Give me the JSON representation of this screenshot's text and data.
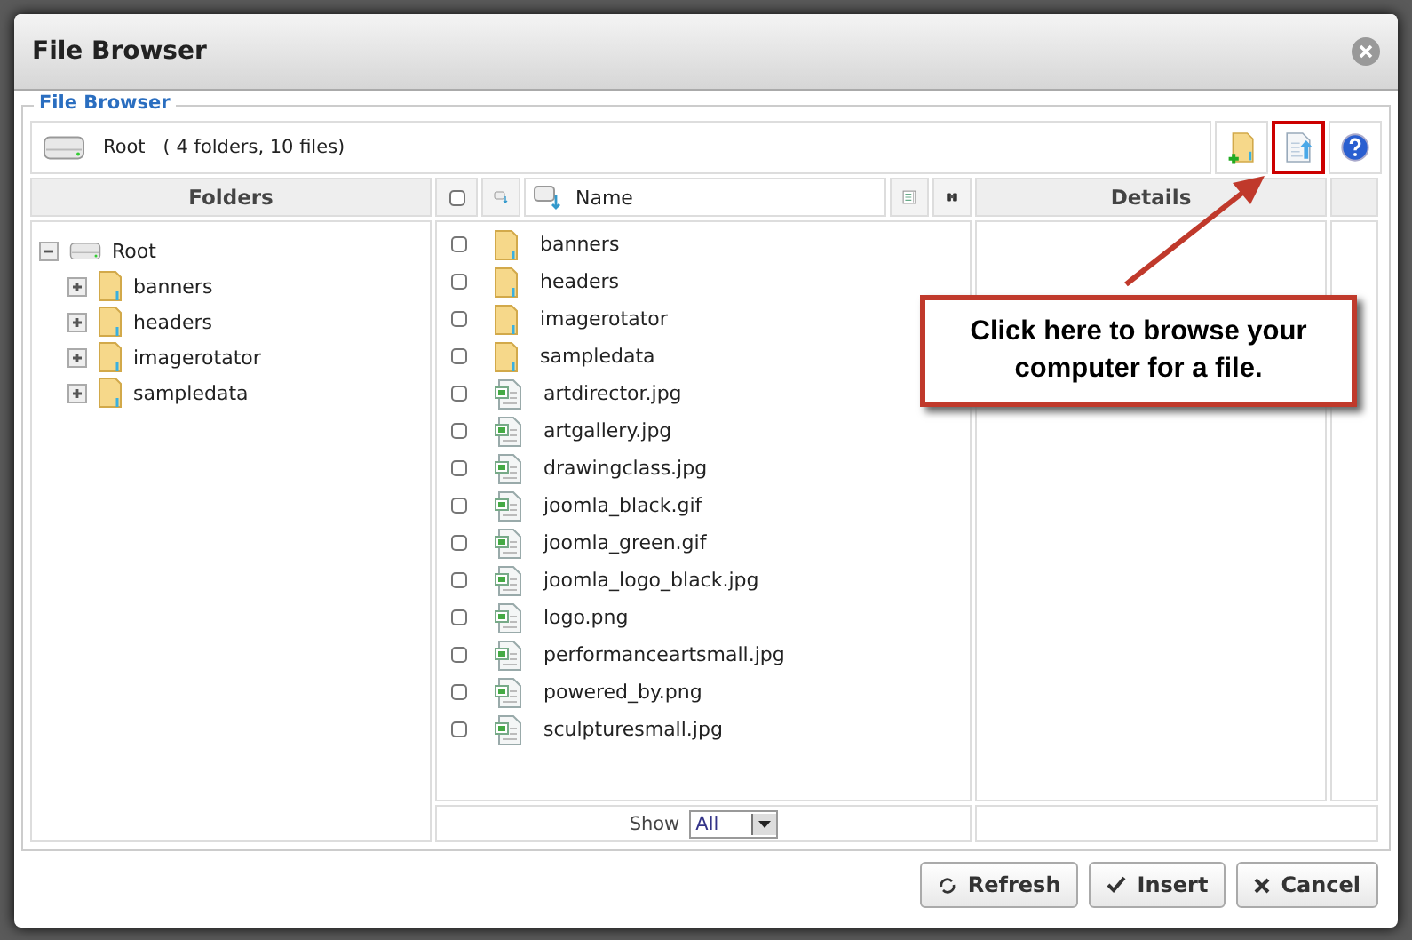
{
  "dialog": {
    "title": "File Browser"
  },
  "fieldset": {
    "legend": "File Browser"
  },
  "location": {
    "name": "Root",
    "summary": "( 4 folders, 10 files)"
  },
  "toolbar": {
    "upload_highlighted": true
  },
  "folders_panel": {
    "heading": "Folders",
    "tree": {
      "label": "Root",
      "expanded": true,
      "children": [
        {
          "label": "banners",
          "expanded": false
        },
        {
          "label": "headers",
          "expanded": false
        },
        {
          "label": "imagerotator",
          "expanded": false
        },
        {
          "label": "sampledata",
          "expanded": false
        }
      ]
    }
  },
  "file_list": {
    "name_heading": "Name",
    "all_checked": false,
    "files": [
      {
        "name": "banners",
        "kind": "folder",
        "checked": false
      },
      {
        "name": "headers",
        "kind": "folder",
        "checked": false
      },
      {
        "name": "imagerotator",
        "kind": "folder",
        "checked": false
      },
      {
        "name": "sampledata",
        "kind": "folder",
        "checked": false
      },
      {
        "name": "artdirector.jpg",
        "kind": "image",
        "checked": false
      },
      {
        "name": "artgallery.jpg",
        "kind": "image",
        "checked": false
      },
      {
        "name": "drawingclass.jpg",
        "kind": "image",
        "checked": false
      },
      {
        "name": "joomla_black.gif",
        "kind": "image",
        "checked": false
      },
      {
        "name": "joomla_green.gif",
        "kind": "image",
        "checked": false
      },
      {
        "name": "joomla_logo_black.jpg",
        "kind": "image",
        "checked": false
      },
      {
        "name": "logo.png",
        "kind": "image",
        "checked": false
      },
      {
        "name": "performanceartsmall.jpg",
        "kind": "image",
        "checked": false
      },
      {
        "name": "powered_by.png",
        "kind": "image",
        "checked": false
      },
      {
        "name": "sculpturesmall.jpg",
        "kind": "image",
        "checked": false
      }
    ],
    "show_label": "Show",
    "show_value": "All"
  },
  "details_panel": {
    "heading": "Details"
  },
  "callout": {
    "text": "Click here to browse your computer for a file."
  },
  "buttons": [
    {
      "label": "Refresh",
      "kind": "refresh"
    },
    {
      "label": "Insert",
      "kind": "insert"
    },
    {
      "label": "Cancel",
      "kind": "cancel"
    }
  ]
}
